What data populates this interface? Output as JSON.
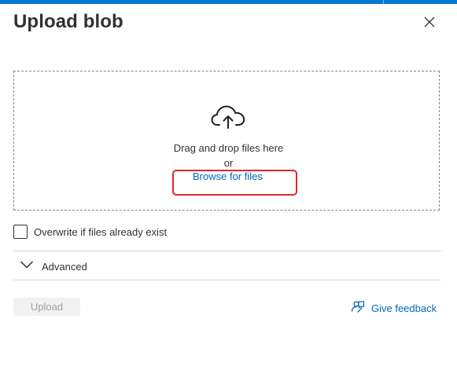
{
  "panel": {
    "title": "Upload blob"
  },
  "dropzone": {
    "line1": "Drag and drop files here",
    "line2": "or",
    "browse_label": "Browse for files"
  },
  "options": {
    "overwrite_label": "Overwrite if files already exist",
    "overwrite_checked": false,
    "advanced_label": "Advanced"
  },
  "footer": {
    "upload_label": "Upload",
    "feedback_label": "Give feedback"
  },
  "icons": {
    "close": "close-icon",
    "cloud_upload": "cloud-upload-icon",
    "chevron": "chevron-down-icon",
    "feedback": "feedback-icon"
  },
  "colors": {
    "accent": "#0078d4",
    "link": "#0067b8",
    "highlight": "#e0262b",
    "disabled_text": "#a19f9d"
  }
}
